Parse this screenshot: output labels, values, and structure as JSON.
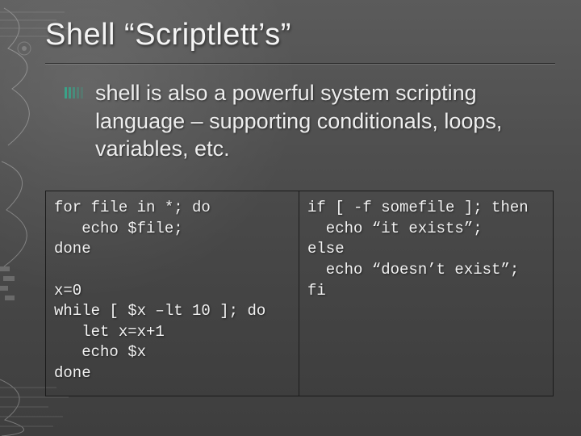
{
  "title": "Shell “Scriptlett’s”",
  "bullet": "shell is also a powerful system scripting language – supporting conditionals, loops, variables, etc.",
  "code_left": "for file in *; do\n   echo $file;\ndone\n\nx=0\nwhile [ $x –lt 10 ]; do\n   let x=x+1\n   echo $x\ndone",
  "code_right": "if [ -f somefile ]; then\n  echo “it exists”;\nelse\n  echo “doesn’t exist”;\nfi"
}
